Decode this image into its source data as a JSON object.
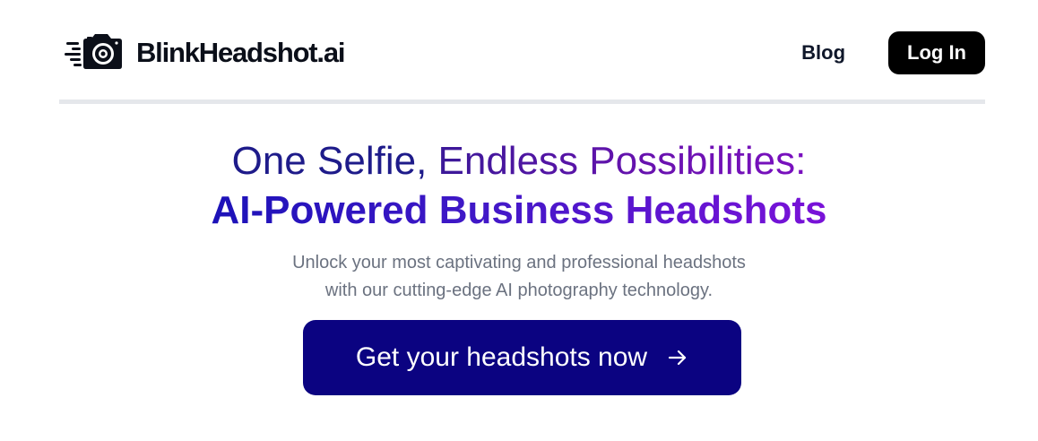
{
  "header": {
    "brand_name": "BlinkHeadshot.ai",
    "logo_icon": "camera-speed-icon",
    "nav": {
      "blog_label": "Blog",
      "login_label": "Log In"
    }
  },
  "hero": {
    "line1_part1": "One Selfie, ",
    "line1_part2": "Endless Possibilities:",
    "line2": "AI-Powered Business Headshots",
    "subtitle_line1": "Unlock your most captivating and professional headshots",
    "subtitle_line2": "with our cutting-edge AI photography technology.",
    "cta_label": "Get your headshots now",
    "cta_icon": "arrow-right-icon"
  },
  "colors": {
    "cta_background": "#0b0381",
    "login_background": "#000000",
    "heading_start": "#1c12b8",
    "heading_end": "#7a12d8",
    "subtitle_text": "#6b7280"
  }
}
